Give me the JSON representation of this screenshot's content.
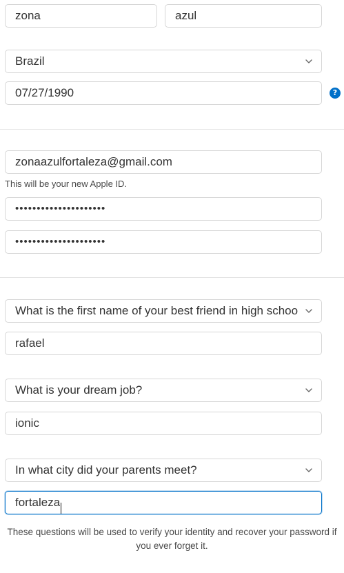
{
  "name": {
    "first_name": "zona",
    "last_name": "azul"
  },
  "country": {
    "selected": "Brazil"
  },
  "birthday": {
    "value": "07/27/1990",
    "help_icon_glyph": "?"
  },
  "account": {
    "email": "zonaazulfortaleza@gmail.com",
    "email_hint": "This will be your new Apple ID.",
    "password_mask": "•••••••••••••••••••••",
    "confirm_password_mask": "•••••••••••••••••••••"
  },
  "security_questions": [
    {
      "question": "What is the first name of your best friend in high school?",
      "answer": "rafael"
    },
    {
      "question": "What is your dream job?",
      "answer": "ionic"
    },
    {
      "question": "In what city did your parents meet?",
      "answer": "fortaleza"
    }
  ],
  "footer_note": "These questions will be used to verify your identity and recover your password if you ever forget it.",
  "colors": {
    "accent": "#0070c9",
    "border": "#d6d6d6",
    "text": "#333333"
  },
  "icons": {
    "chevron": "chevron-down-icon",
    "help": "help-icon"
  }
}
